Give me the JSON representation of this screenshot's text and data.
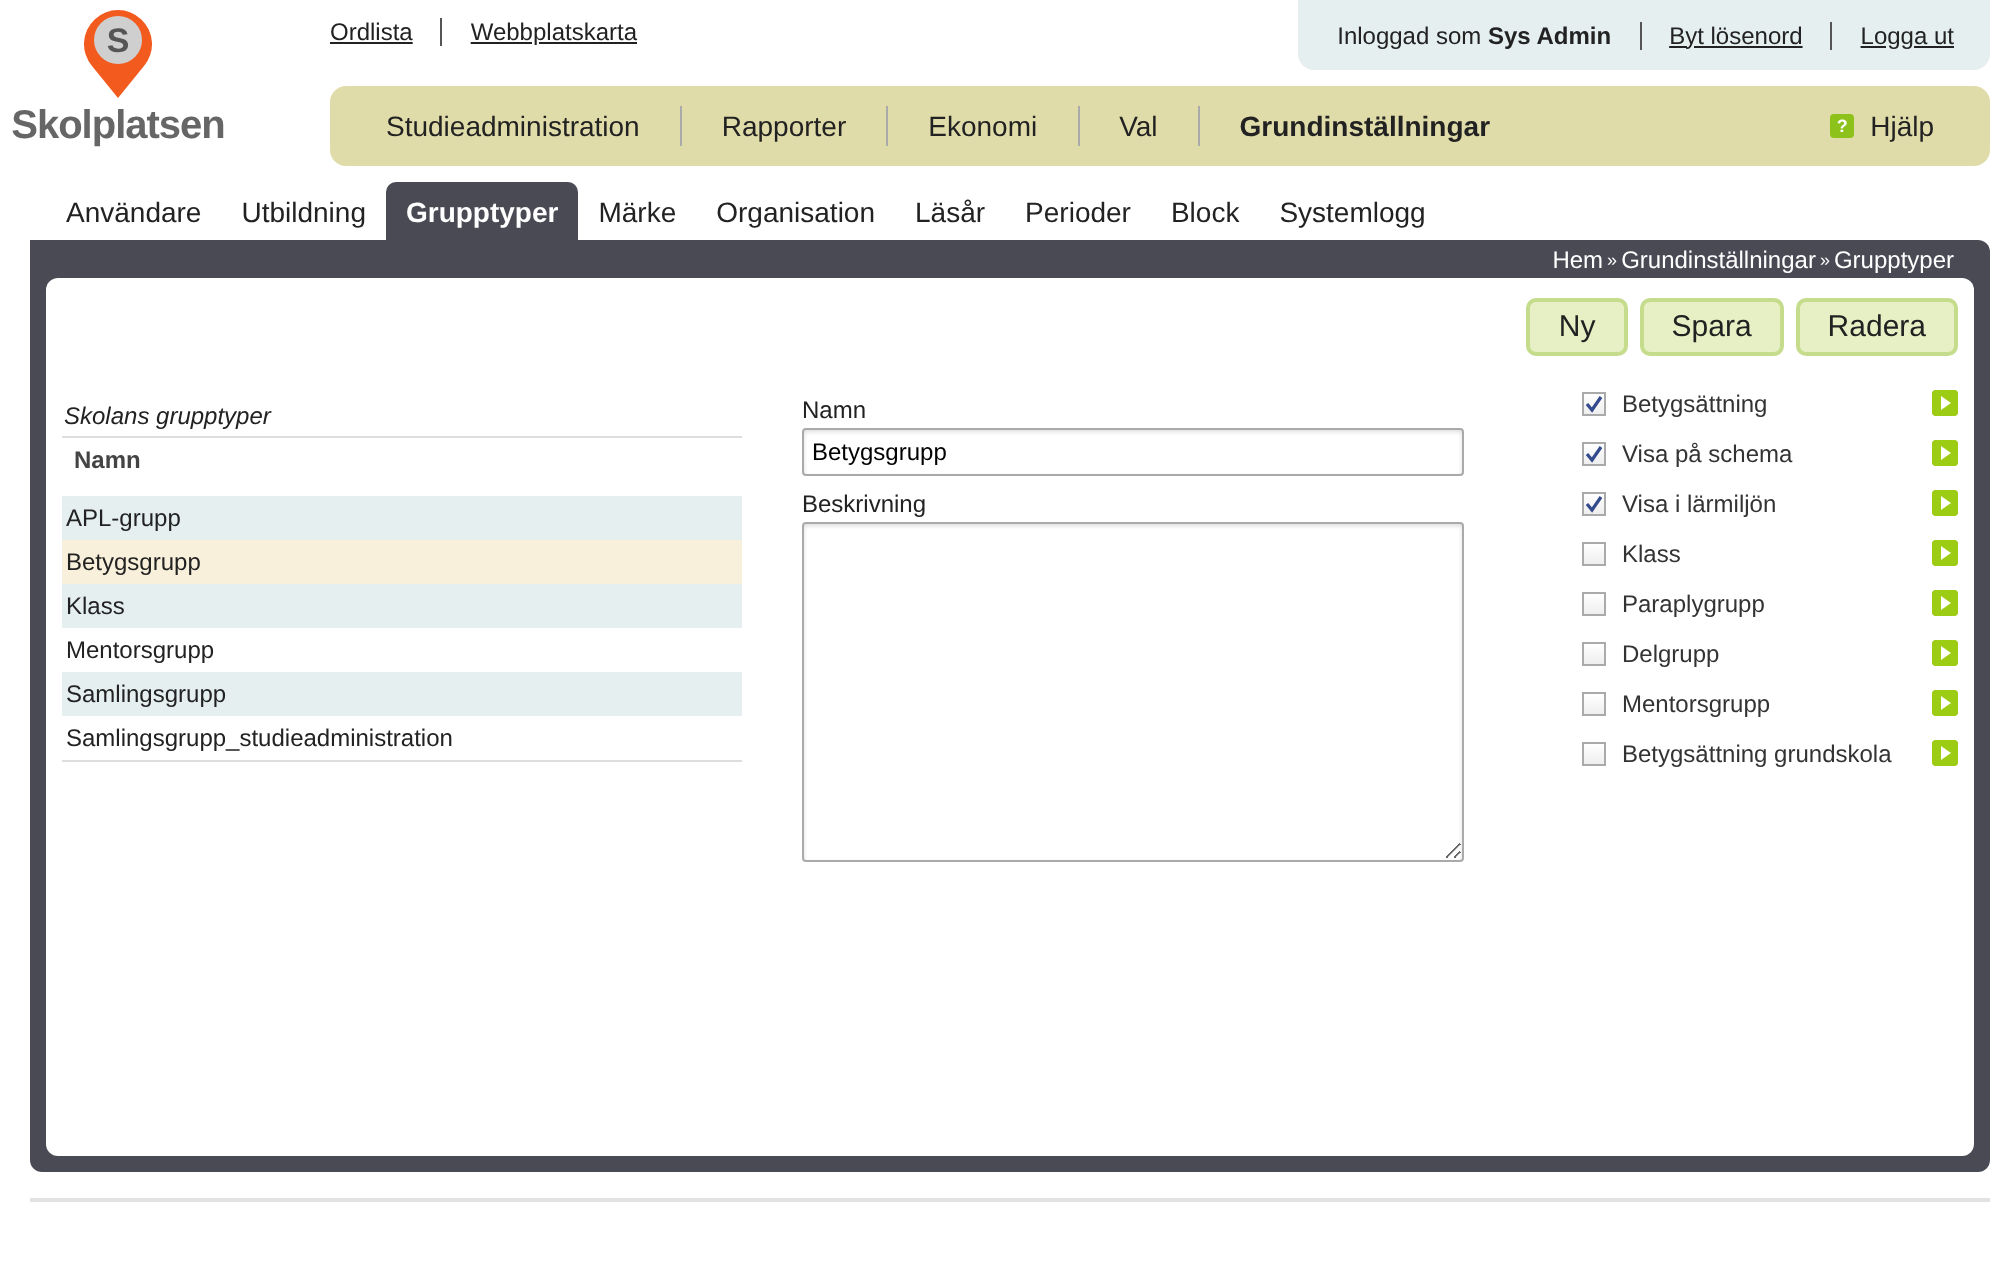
{
  "logo": {
    "mark": "S",
    "name": "Skolplatsen"
  },
  "top_links": [
    "Ordlista",
    "Webbplatskarta"
  ],
  "user_bar": {
    "prefix": "Inloggad som",
    "user": "Sys Admin",
    "links": [
      "Byt lösenord",
      "Logga ut"
    ]
  },
  "main_nav": [
    {
      "label": "Studieadministration",
      "selected": false
    },
    {
      "label": "Rapporter",
      "selected": false
    },
    {
      "label": "Ekonomi",
      "selected": false
    },
    {
      "label": "Val",
      "selected": false
    },
    {
      "label": "Grundinställningar",
      "selected": true
    }
  ],
  "help": {
    "icon": "?",
    "label": "Hjälp"
  },
  "tabs": [
    {
      "label": "Användare",
      "selected": false
    },
    {
      "label": "Utbildning",
      "selected": false
    },
    {
      "label": "Grupptyper",
      "selected": true
    },
    {
      "label": "Märke",
      "selected": false
    },
    {
      "label": "Organisation",
      "selected": false
    },
    {
      "label": "Läsår",
      "selected": false
    },
    {
      "label": "Perioder",
      "selected": false
    },
    {
      "label": "Block",
      "selected": false
    },
    {
      "label": "Systemlogg",
      "selected": false
    }
  ],
  "breadcrumb": {
    "separator": "»",
    "items": [
      "Hem",
      "Grundinställningar",
      "Grupptyper"
    ]
  },
  "buttons": [
    "Ny",
    "Spara",
    "Radera"
  ],
  "group_list": {
    "title": "Skolans grupptyper",
    "column": "Namn",
    "rows": [
      {
        "name": "APL-grupp",
        "selected": false
      },
      {
        "name": "Betygsgrupp",
        "selected": true
      },
      {
        "name": "Klass",
        "selected": false
      },
      {
        "name": "Mentorsgrupp",
        "selected": false
      },
      {
        "name": "Samlingsgrupp",
        "selected": false
      },
      {
        "name": "Samlingsgrupp_studieadministration",
        "selected": false
      }
    ]
  },
  "form": {
    "name_label": "Namn",
    "name_value": "Betygsgrupp",
    "description_label": "Beskrivning"
  },
  "options": [
    {
      "label": "Betygsättning",
      "checked": true
    },
    {
      "label": "Visa på schema",
      "checked": true
    },
    {
      "label": "Visa i lärmiljön",
      "checked": true
    },
    {
      "label": "Klass",
      "checked": false
    },
    {
      "label": "Paraplygrupp",
      "checked": false
    },
    {
      "label": "Delgrupp",
      "checked": false
    },
    {
      "label": "Mentorsgrupp",
      "checked": false
    },
    {
      "label": "Betygsättning grundskola",
      "checked": false
    }
  ]
}
